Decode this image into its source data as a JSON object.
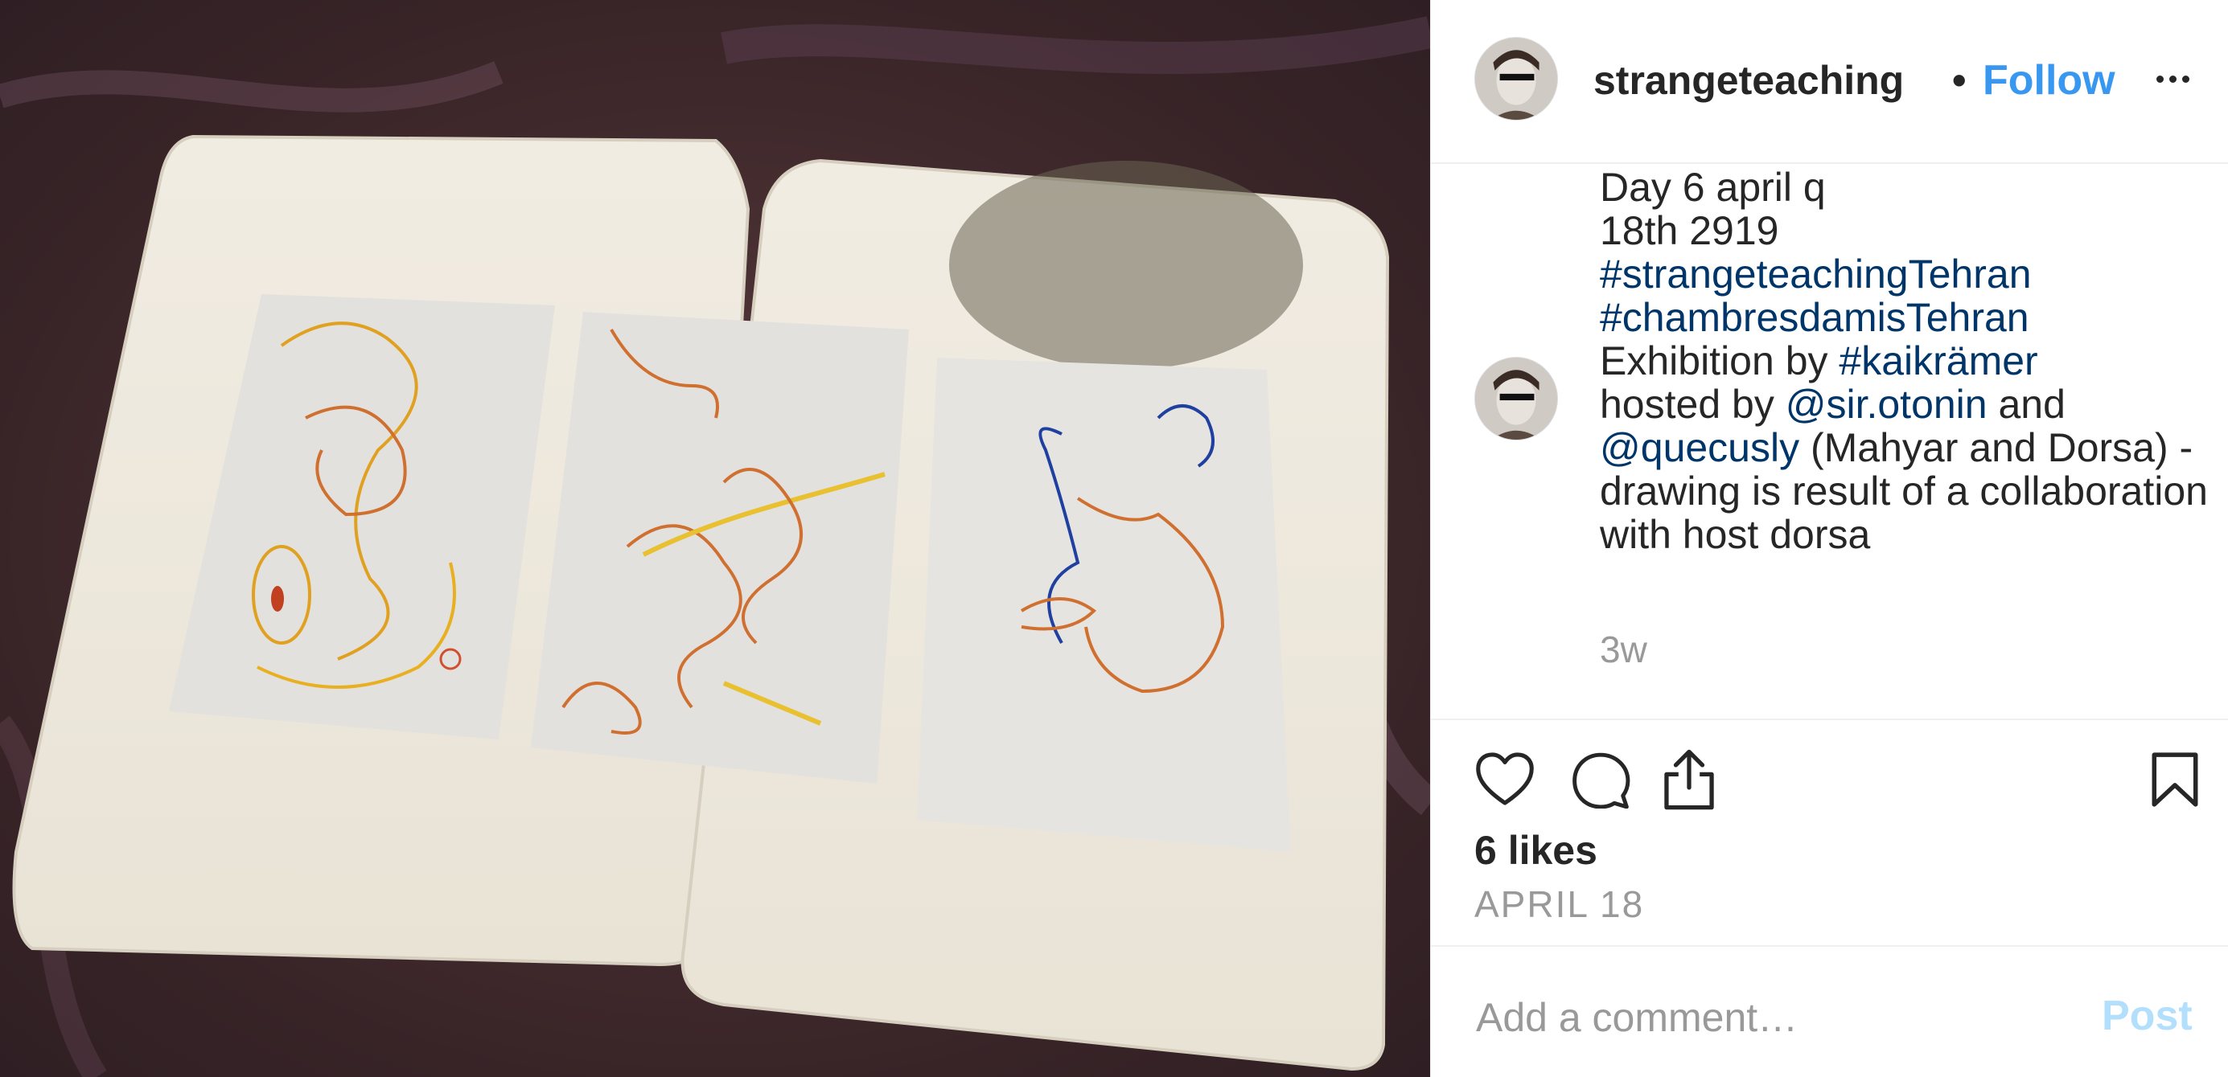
{
  "post": {
    "username": "strangeteaching",
    "separator": "•",
    "follow_label": "Follow",
    "caption": {
      "line1": "Day 6 april q",
      "line2": "18th 2919",
      "tag1": "#strangeteachingTehran",
      "tag2": "#chambresdamisTehran",
      "text_exhibition": "Exhibition by ",
      "tag3": "#kaikrämer",
      "text_hosted": "hosted by ",
      "mention1": "@sir.otonin",
      "text_and": " and",
      "mention2": "@quecusly",
      "text_rest": " (Mahyar and Dorsa) - drawing is result of a collaboration with host dorsa"
    },
    "time_ago": "3w",
    "likes": "6 likes",
    "date": "APRIL 18",
    "comment_placeholder": "Add a comment…",
    "post_label": "Post"
  },
  "photo": {
    "description_icons": [
      "drawing-sheet-left",
      "drawing-sheet-middle",
      "drawing-sheet-right"
    ]
  },
  "colors": {
    "link": "#003569",
    "follow": "#3897f0",
    "post_disabled": "#b2dffc",
    "muted": "#999999",
    "text": "#262626"
  },
  "icons": [
    "heart-icon",
    "comment-icon",
    "share-icon",
    "bookmark-icon",
    "more-options-icon"
  ]
}
